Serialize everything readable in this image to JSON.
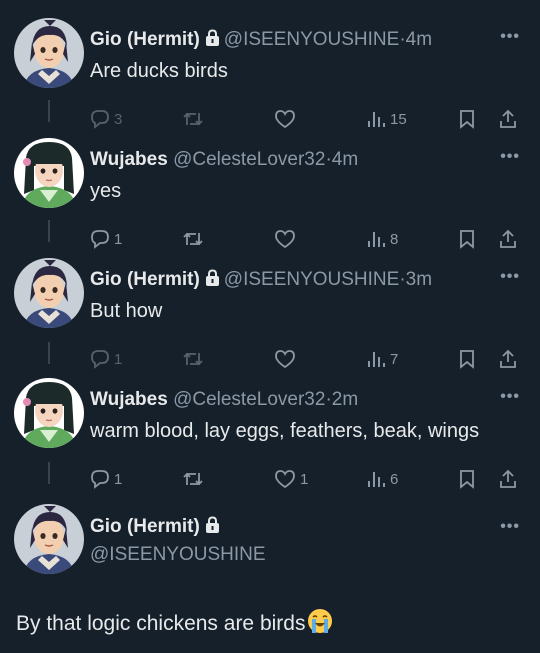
{
  "tweets": [
    {
      "name": "Gio (Hermit)",
      "handle": "@ISEENYOUSHINE",
      "time": "4m",
      "text": "Are ducks birds",
      "reply_count": "3",
      "retweet_count": "",
      "like_count": "",
      "view_count": "15"
    },
    {
      "name": "Wujabes",
      "handle": "@CelesteLover32",
      "time": "4m",
      "text": "yes",
      "reply_count": "1",
      "retweet_count": "",
      "like_count": "",
      "view_count": "8"
    },
    {
      "name": "Gio (Hermit)",
      "handle": "@ISEENYOUSHINE",
      "time": "3m",
      "text": "But how",
      "reply_count": "1",
      "retweet_count": "",
      "like_count": "",
      "view_count": "7"
    },
    {
      "name": "Wujabes",
      "handle": "@CelesteLover32",
      "time": "2m",
      "text": "warm blood, lay eggs, feathers, beak, wings",
      "reply_count": "1",
      "retweet_count": "",
      "like_count": "1",
      "view_count": "6"
    }
  ],
  "final_tweet": {
    "name": "Gio (Hermit)",
    "handle": "@ISEENYOUSHINE",
    "text": "By that logic chickens are birds"
  },
  "separator": "·",
  "more_label": "•••",
  "icons": {
    "lock": "lock-icon",
    "reply": "reply-icon",
    "retweet": "retweet-icon",
    "like": "heart-icon",
    "views": "views-icon",
    "bookmark": "bookmark-icon",
    "share": "share-icon",
    "emoji": "crying-emoji"
  },
  "colors": {
    "background": "#15202b",
    "text": "#e7e9ea",
    "muted": "#8b98a5",
    "thread_line": "#38444d"
  }
}
